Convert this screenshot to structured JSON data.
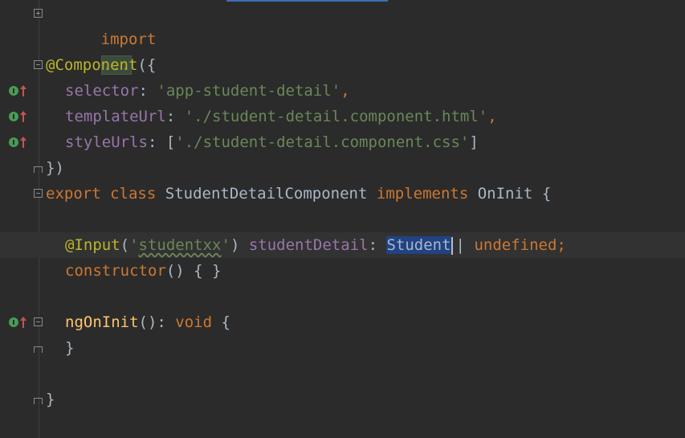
{
  "editor": {
    "lines": [
      {
        "import_kw": "import",
        "folded": "..."
      },
      {},
      {
        "annotation": "@Component",
        "punct": "({"
      },
      {
        "key": "selector",
        "colon": ": ",
        "value": "'app-student-detail'",
        "comma": ","
      },
      {
        "key": "templateUrl",
        "colon": ": ",
        "value": "'./student-detail.component.html'",
        "comma": ","
      },
      {
        "key": "styleUrls",
        "colon": ": [",
        "value": "'./student-detail.component.css'",
        "close": "]"
      },
      {
        "text": "})"
      },
      {
        "export_kw": "export",
        "class_kw": "class",
        "class_name": "StudentDetailComponent",
        "implements_kw": "implements",
        "iface": "OnInit",
        "brace": "{"
      },
      {},
      {
        "annotation": "@Input",
        "open": "(",
        "q1": "'",
        "arg": "studentxx",
        "q2": "'",
        "close": ")",
        "prop": "studentDetail",
        "colon": ": ",
        "type": "Student",
        "pipe": "| ",
        "undefined": "undefined",
        "semi": ";"
      },
      {
        "ctor": "constructor",
        "rest": "() { }"
      },
      {},
      {
        "method": "ngOnInit",
        "paren": "(): ",
        "void_kw": "void",
        "brace": "{"
      },
      {
        "text": "}"
      },
      {},
      {
        "text": "}"
      }
    ]
  },
  "colors": {
    "background": "#2b2b2b",
    "keyword": "#cc7832",
    "string": "#6a8759",
    "property": "#9876aa",
    "function": "#ffc66d",
    "selection": "#214283",
    "override_icon": "#499c54",
    "override_arrow": "#c75450"
  },
  "icons": {
    "gutter_override": "override-up-arrow-icon",
    "fold_marker": "fold-marker-icon"
  }
}
